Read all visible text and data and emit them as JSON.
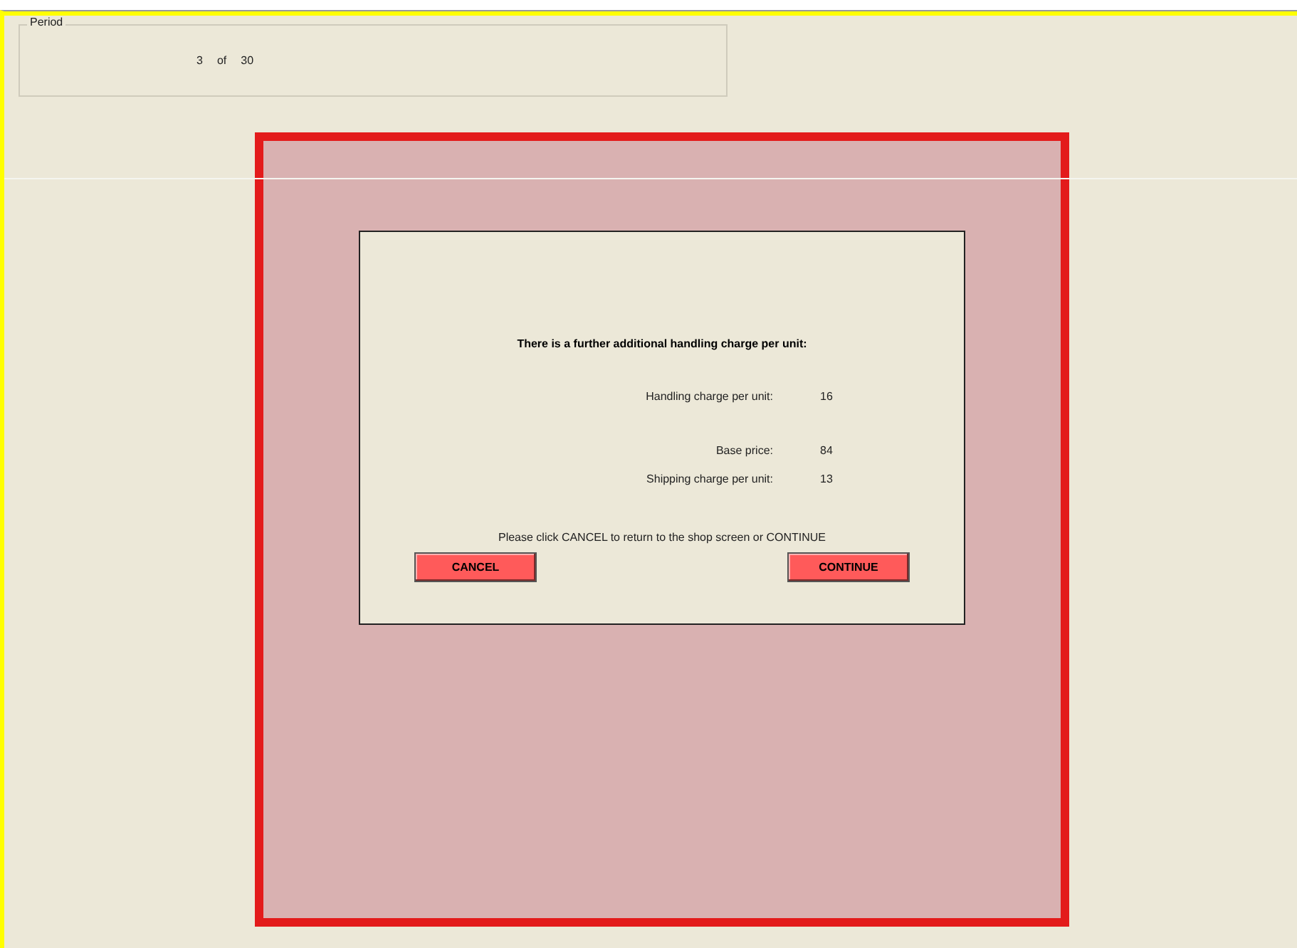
{
  "period": {
    "legend": "Period",
    "current": "3",
    "separator": "of",
    "total": "30"
  },
  "dialog": {
    "heading": "There is a further additional handling charge per unit:",
    "charge_groups": [
      [
        {
          "label": "Handling charge per unit:",
          "value": "16"
        }
      ],
      [
        {
          "label": "Base price:",
          "value": "84"
        },
        {
          "label": "Shipping charge per unit:",
          "value": "13"
        }
      ]
    ],
    "instruction": "Please click CANCEL to return to the shop screen or CONTINUE",
    "buttons": [
      "CANCEL",
      "CONTINUE"
    ]
  }
}
